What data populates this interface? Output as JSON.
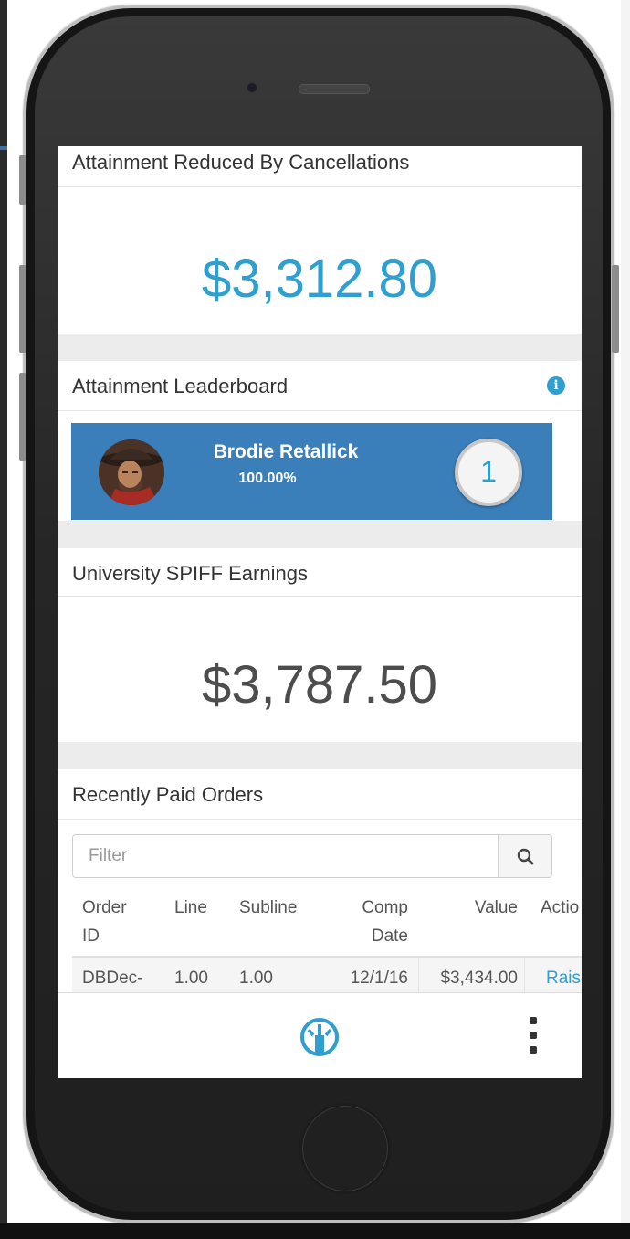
{
  "cards": {
    "cancellations": {
      "title": "Attainment Reduced By Cancellations",
      "value": "$3,312.80"
    },
    "leaderboard": {
      "title": "Attainment Leaderboard",
      "entries": [
        {
          "name": "Brodie Retallick",
          "percent": "100.00%",
          "rank": "1"
        }
      ]
    },
    "spiff": {
      "title": "University SPIFF Earnings",
      "value": "$3,787.50"
    },
    "orders": {
      "title": "Recently Paid Orders",
      "filter_placeholder": "Filter",
      "columns": {
        "order_id_1": "Order",
        "order_id_2": "ID",
        "line": "Line",
        "subline": "Subline",
        "comp_date_1": "Comp",
        "comp_date_2": "Date",
        "value": "Value",
        "action": "Actio"
      },
      "rows": [
        {
          "order_id": "DBDec-",
          "line": "1.00",
          "subline": "1.00",
          "comp_date": "12/1/16",
          "value": "$3,434.00",
          "action": "Raise"
        }
      ]
    }
  },
  "colors": {
    "accent": "#2e9fcf",
    "leaderboard_bg": "#3a7fba"
  },
  "icons": {
    "info": "info-icon",
    "search": "search-icon",
    "dashboard": "dashboard-icon",
    "more": "more-vertical-icon"
  }
}
